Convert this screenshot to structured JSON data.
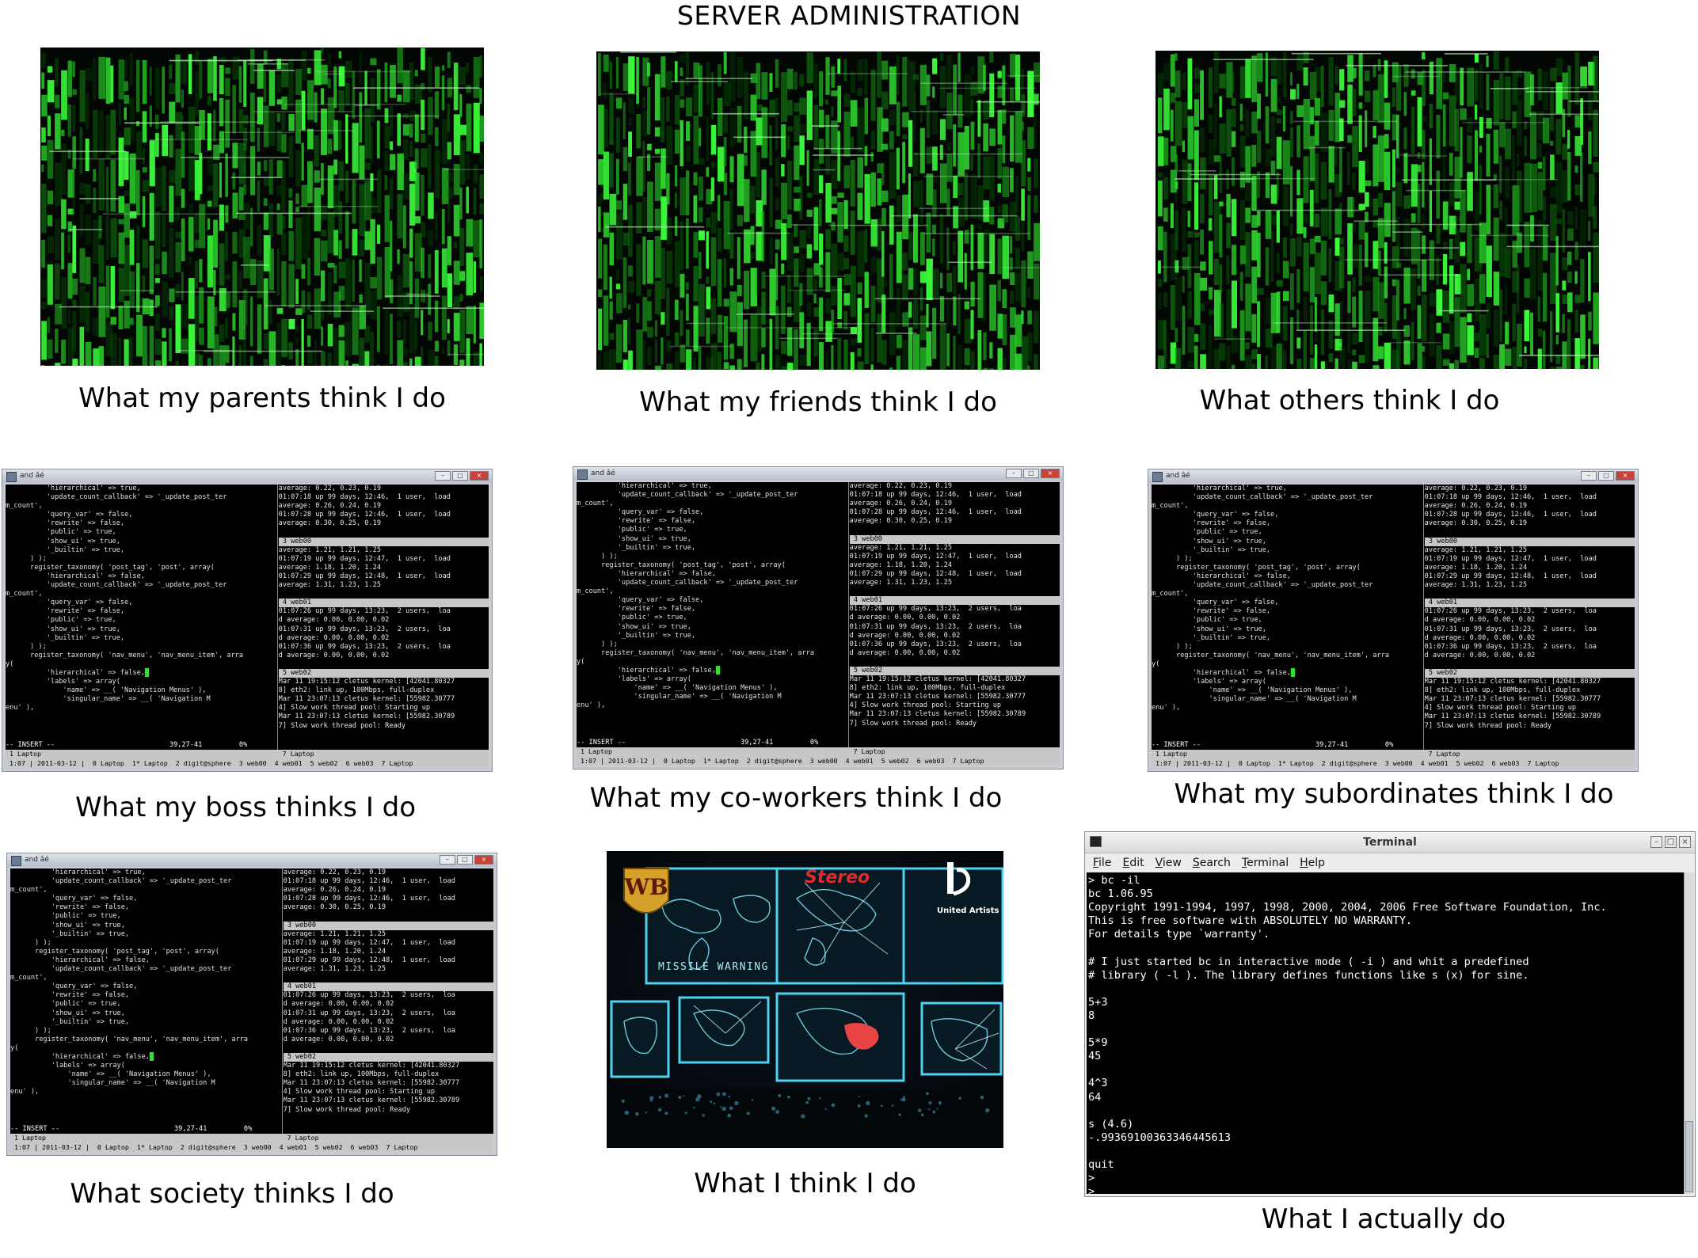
{
  "title": "SERVER ADMINISTRATION",
  "captions": {
    "parents": "What my parents think I do",
    "friends": "What my friends think I do",
    "others": "What others think I do",
    "boss": "What my boss thinks I do",
    "coworkers": "What my co-workers think I do",
    "subordinates": "What my subordinates think I do",
    "society": "What society thinks I do",
    "self": "What I think I do",
    "actual": "What I actually do"
  },
  "colors": {
    "matrix_green": "#33d43a",
    "terminal_red": "#cc2a2a",
    "war_cyan": "#3fc6e6"
  },
  "screen": {
    "window_title": "and âé",
    "left_lines": [
      {
        "t": "          'hierarchical' => true,",
        "c": "r"
      },
      {
        "t": "          'update_count_callback' => '_update_post_ter",
        "c": "r"
      },
      {
        "t": "m_count',",
        "c": "r"
      },
      {
        "t": "          'query_var' => false,",
        "c": "r"
      },
      {
        "t": "          'rewrite' => false,",
        "c": "r"
      },
      {
        "t": "          'public' => true,",
        "c": "r"
      },
      {
        "t": "          'show_ui' => true,",
        "c": "r"
      },
      {
        "t": "          '_builtin' => true,",
        "c": "r"
      },
      {
        "t": "      ) );",
        "c": "w"
      },
      {
        "t": "",
        "c": "w"
      },
      {
        "t": "      register_taxonomy( 'post_tag', 'post', array(",
        "c": "w"
      },
      {
        "t": "          'hierarchical' => false,",
        "c": "r"
      },
      {
        "t": "          'update_count_callback' => '_update_post_ter",
        "c": "r"
      },
      {
        "t": "m_count',",
        "c": "r"
      },
      {
        "t": "          'query_var' => false,",
        "c": "r"
      },
      {
        "t": "          'rewrite' => false,",
        "c": "r"
      },
      {
        "t": "          'public' => true,",
        "c": "r"
      },
      {
        "t": "          'show_ui' => true,",
        "c": "r"
      },
      {
        "t": "          '_builtin' => true,",
        "c": "r"
      },
      {
        "t": "      ) );",
        "c": "w"
      },
      {
        "t": "",
        "c": "w"
      },
      {
        "t": "      register_taxonomy( 'nav_menu', 'nav_menu_item', arra",
        "c": "w"
      },
      {
        "t": "y(",
        "c": "g"
      },
      {
        "t": "          'hierarchical' => false,",
        "c": "r"
      },
      {
        "t": "          'labels' => array(",
        "c": "r"
      },
      {
        "t": "              'name' => __( 'Navigation Menus' ),",
        "c": "r"
      },
      {
        "t": "              'singular_name' => __( 'Navigation M",
        "c": "r"
      },
      {
        "t": "enu' ),",
        "c": "r"
      }
    ],
    "insert_line": "-- INSERT --                            39,27-41         0%",
    "right_lines": [
      {
        "t": "average: 0.22, 0.23, 0.19",
        "h": false
      },
      {
        "t": "01:07:18 up 99 days, 12:46,  1 user,  load",
        "h": false
      },
      {
        "t": "average: 0.26, 0.24, 0.19",
        "h": false
      },
      {
        "t": "01:07:28 up 99 days, 12:46,  1 user,  load",
        "h": false
      },
      {
        "t": "average: 0.30, 0.25, 0.19",
        "h": false
      },
      {
        "t": "",
        "h": false
      },
      {
        "t": " 3 web00",
        "h": true
      },
      {
        "t": "average: 1.21, 1.21, 1.25",
        "h": false
      },
      {
        "t": "01:07:19 up 99 days, 12:47,  1 user,  load",
        "h": false
      },
      {
        "t": "average: 1.18, 1.20, 1.24",
        "h": false
      },
      {
        "t": "01:07:29 up 99 days, 12:48,  1 user,  load",
        "h": false
      },
      {
        "t": "average: 1.31, 1.23, 1.25",
        "h": false
      },
      {
        "t": "",
        "h": false
      },
      {
        "t": " 4 web01",
        "h": true
      },
      {
        "t": "01:07:26 up 99 days, 13:23,  2 users,  loa",
        "h": false
      },
      {
        "t": "d average: 0.00, 0.00, 0.02",
        "h": false
      },
      {
        "t": "01:07:31 up 99 days, 13:23,  2 users,  loa",
        "h": false
      },
      {
        "t": "d average: 0.00, 0.00, 0.02",
        "h": false
      },
      {
        "t": "01:07:36 up 99 days, 13:23,  2 users,  loa",
        "h": false
      },
      {
        "t": "d average: 0.00, 0.00, 0.02",
        "h": false
      },
      {
        "t": "",
        "h": false
      },
      {
        "t": " 5 web02",
        "h": true
      },
      {
        "t": "Mar 11 19:15:12 cletus kernel: [42041.80327",
        "h": false
      },
      {
        "t": "8] eth2: link up, 100Mbps, full-duplex",
        "h": false
      },
      {
        "t": "Mar 11 23:07:13 cletus kernel: [55982.30777",
        "h": false
      },
      {
        "t": "4] Slow work thread pool: Starting up",
        "h": false
      },
      {
        "t": "Mar 11 23:07:13 cletus kernel: [55982.30789",
        "h": false
      },
      {
        "t": "7] Slow work thread pool: Ready",
        "h": false
      }
    ],
    "pane_label_left": " 1 Laptop",
    "pane_label_right": " 7 Laptop",
    "status_bar": " 1:07 | 2011-03-12 |  0 Laptop  1* Laptop  2 digit@sphere  3 web00  4 web01  5 web02  6 web03  7 Laptop"
  },
  "war_room": {
    "missile_warning": "MISSILE WARNING",
    "stereo": "Stereo",
    "united_artists": "United Artists"
  },
  "terminal": {
    "title": "Terminal",
    "menu": [
      "File",
      "Edit",
      "View",
      "Search",
      "Terminal",
      "Help"
    ],
    "lines": [
      "> bc -il",
      "bc 1.06.95",
      "Copyright 1991-1994, 1997, 1998, 2000, 2004, 2006 Free Software Foundation, Inc.",
      "This is free software with ABSOLUTELY NO WARRANTY.",
      "For details type `warranty'.",
      "",
      "# I just started bc in interactive mode ( -i ) and whit a predefined",
      "# library ( -l ). The library defines functions like s (x) for sine.",
      "",
      "5+3",
      "8",
      "",
      "5*9",
      "45",
      "",
      "4^3",
      "64",
      "",
      "s (4.6)",
      "-.99369100363346445613",
      "",
      "quit",
      ">",
      ">"
    ]
  }
}
